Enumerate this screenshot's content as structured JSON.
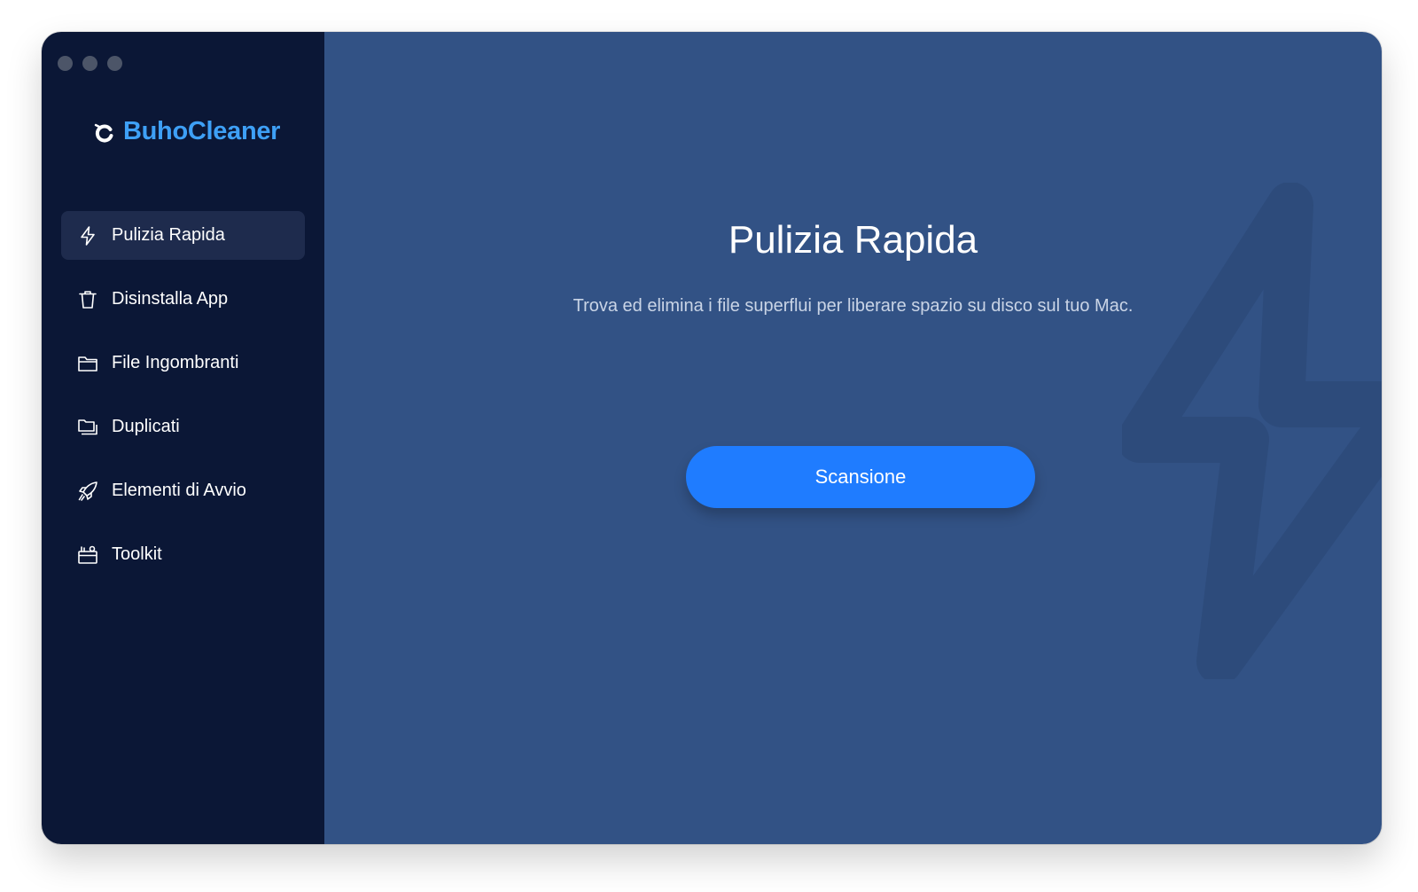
{
  "window": {
    "controls": [
      "close",
      "minimize",
      "zoom"
    ]
  },
  "app": {
    "name": "BuhoCleaner",
    "brand_color": "#3ea0f6"
  },
  "sidebar": {
    "items": [
      {
        "label": "Pulizia Rapida",
        "icon": "bolt-icon",
        "active": true
      },
      {
        "label": "Disinstalla App",
        "icon": "trash-icon",
        "active": false
      },
      {
        "label": "File Ingombranti",
        "icon": "folder-icon",
        "active": false
      },
      {
        "label": "Duplicati",
        "icon": "duplicate-folder-icon",
        "active": false
      },
      {
        "label": "Elementi di Avvio",
        "icon": "rocket-icon",
        "active": false
      },
      {
        "label": "Toolkit",
        "icon": "toolbox-icon",
        "active": false
      }
    ]
  },
  "main": {
    "title": "Pulizia Rapida",
    "description": "Trova ed elimina i file superflui per liberare spazio su disco sul tuo Mac.",
    "scan_button_label": "Scansione",
    "background_icon": "bolt-icon",
    "accent_color": "#1f7cff",
    "background_color": "#325285"
  }
}
